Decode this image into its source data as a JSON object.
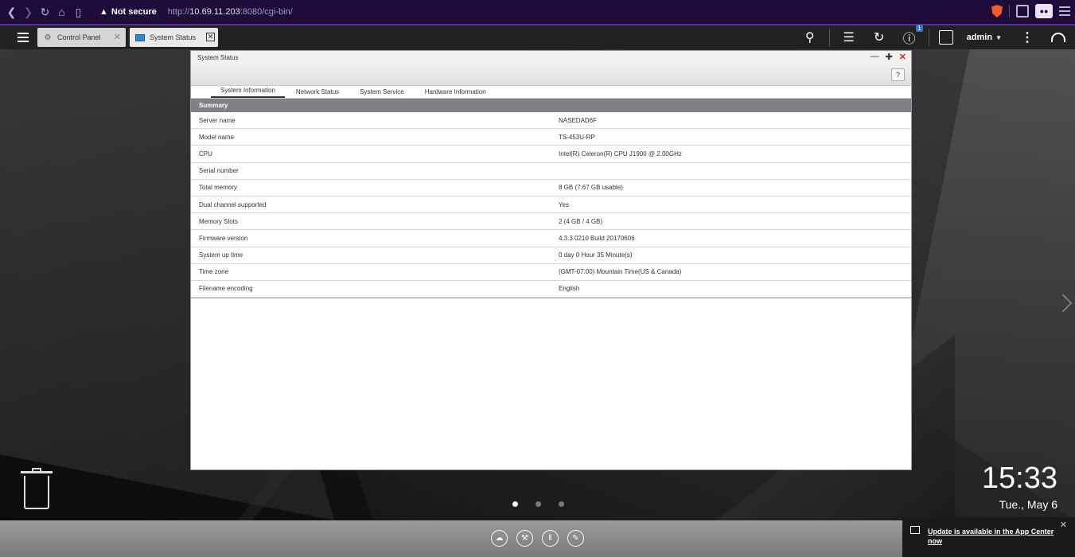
{
  "browser": {
    "security_label": "Not secure",
    "url_scheme": "http://",
    "url_host": "10.69.11.203",
    "url_rest": ":8080/cgi-bin/"
  },
  "taskbar": {
    "tabs": [
      {
        "label": "Control Panel"
      },
      {
        "label": "System Status"
      }
    ],
    "info_badge": "1",
    "user": "admin"
  },
  "window": {
    "title": "System Status",
    "help_label": "?",
    "tabs": [
      "System Information",
      "Network Status",
      "System Service",
      "Hardware Information"
    ],
    "section": "Summary",
    "rows": [
      {
        "key": "Server name",
        "value": "NASEDAD6F"
      },
      {
        "key": "Model name",
        "value": "TS-453U-RP"
      },
      {
        "key": "CPU",
        "value": "Intel(R) Celeron(R) CPU J1900 @ 2.00GHz"
      },
      {
        "key": "Serial number",
        "value": ""
      },
      {
        "key": "Total memory",
        "value": "8 GB (7.67 GB usable)"
      },
      {
        "key": "Dual channel supported",
        "value": "Yes"
      },
      {
        "key": "Memory Slots",
        "value": "2 (4 GB / 4 GB)"
      },
      {
        "key": "Firmware version",
        "value": "4.3.3.0210 Build 20170606"
      },
      {
        "key": "System up time",
        "value": "0 day 0 Hour 35 Minute(s)"
      },
      {
        "key": "Time zone",
        "value": "(GMT-07:00) Mountain Time(US & Canada)"
      },
      {
        "key": "Filename encoding",
        "value": "English"
      }
    ]
  },
  "desktop": {
    "clock": "15:33",
    "date": "Tue., May 6"
  },
  "notification": {
    "text": "Update is available in the App Center now"
  },
  "icons": {
    "back": "back-arrow-icon",
    "forward": "forward-arrow-icon",
    "reload": "reload-icon",
    "home": "home-icon",
    "bookmark": "bookmark-icon",
    "brave": "brave-shield-icon",
    "search": "search-icon",
    "trash": "trash-icon"
  }
}
